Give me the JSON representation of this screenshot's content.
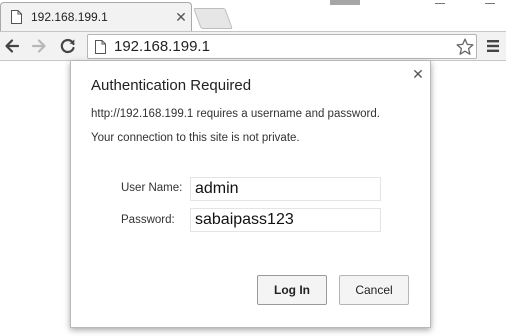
{
  "tab": {
    "title": "192.168.199.1"
  },
  "toolbar": {
    "address": "192.168.199.1"
  },
  "dialog": {
    "title": "Authentication Required",
    "message_line1": "http://192.168.199.1 requires a username and password.",
    "message_line2": "Your connection to this site is not private.",
    "username_label": "User Name:",
    "username_value": "admin",
    "password_label": "Password:",
    "password_value": "sabaipass123",
    "login_label": "Log In",
    "cancel_label": "Cancel"
  },
  "icons": {
    "tab_favicon": "page-icon",
    "tab_close": "close-icon",
    "back": "arrow-left-icon",
    "forward": "arrow-right-icon",
    "reload": "reload-icon",
    "bookmark": "star-icon",
    "menu": "hamburger-menu-icon",
    "dialog_close": "close-icon"
  }
}
